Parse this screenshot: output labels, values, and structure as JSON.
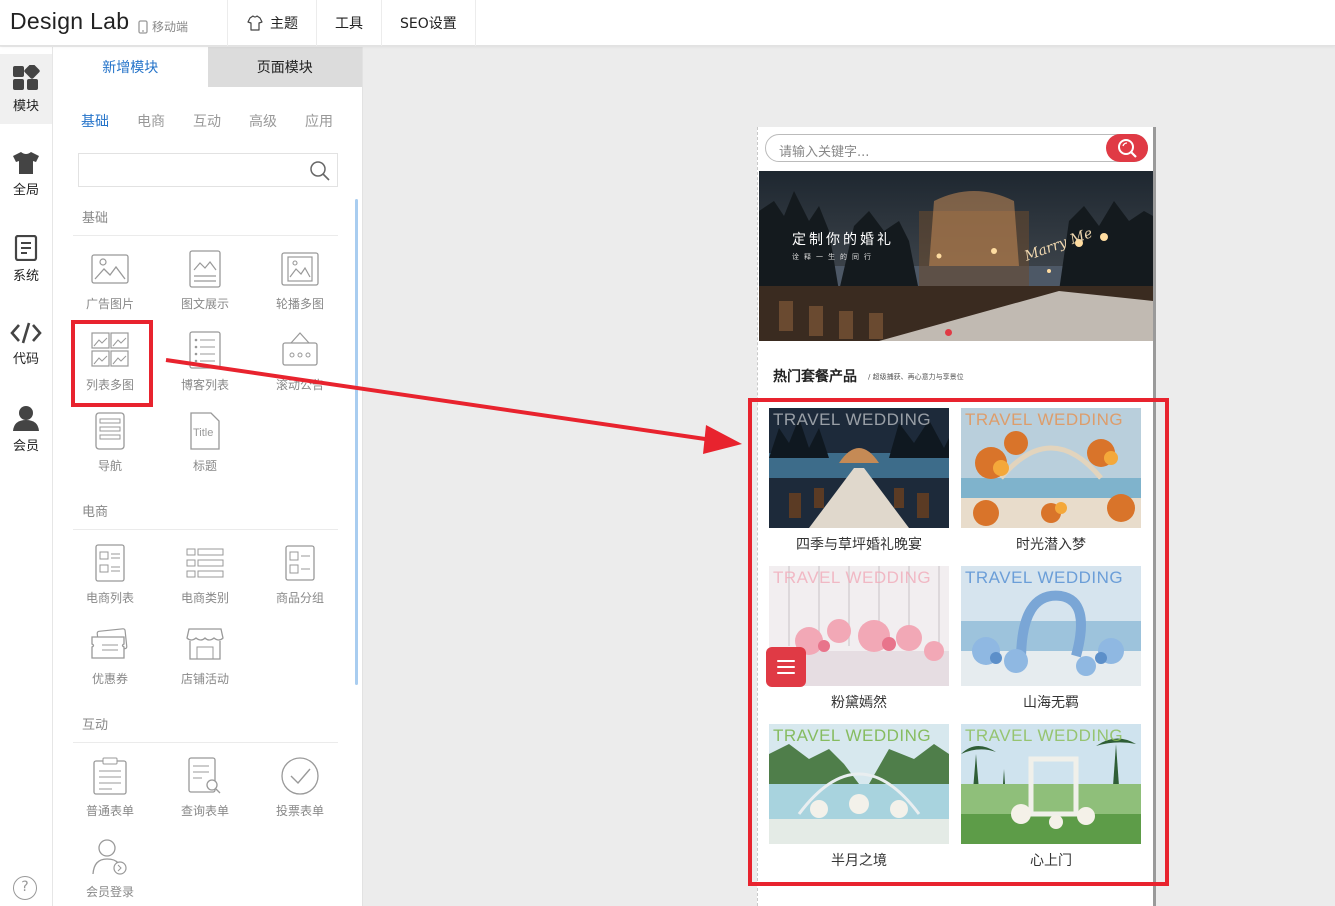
{
  "app": {
    "brand": "Design Lab",
    "mobile_label": "移动端"
  },
  "topnav": [
    {
      "label": "主题",
      "icon": "theme-icon"
    },
    {
      "label": "工具"
    },
    {
      "label": "SEO设置"
    }
  ],
  "rail": [
    {
      "label": "模块",
      "icon": "blocks-icon",
      "active": true
    },
    {
      "label": "全局",
      "icon": "shirt-icon"
    },
    {
      "label": "系统",
      "icon": "document-icon"
    },
    {
      "label": "代码",
      "icon": "code-icon"
    },
    {
      "label": "会员",
      "icon": "user-icon"
    }
  ],
  "help_label": "?",
  "panel": {
    "tabs": [
      "新增模块",
      "页面模块"
    ],
    "categories": [
      "基础",
      "电商",
      "互动",
      "高级",
      "应用"
    ],
    "search_placeholder": "",
    "sections": {
      "basic": {
        "title": "基础",
        "items": [
          "广告图片",
          "图文展示",
          "轮播多图",
          "列表多图",
          "博客列表",
          "滚动公告",
          "导航",
          "标题"
        ]
      },
      "ecommerce": {
        "title": "电商",
        "items": [
          "电商列表",
          "电商类别",
          "商品分组",
          "优惠券",
          "店铺活动"
        ]
      },
      "interaction": {
        "title": "互动",
        "items": [
          "普通表单",
          "查询表单",
          "投票表单",
          "会员登录"
        ]
      }
    }
  },
  "preview": {
    "search_placeholder": "请输入关键字...",
    "banner_title": "定制你的婚礼",
    "banner_subtitle": "诠释一生的同行",
    "section_title": "热门套餐产品",
    "section_subtitle": "/ 超级捕获、再心意力与享景位",
    "products": [
      {
        "name": "四季与草坪婚礼晚宴",
        "overlay": "TRAVEL WEDDING"
      },
      {
        "name": "时光潜入梦",
        "overlay": "TRAVEL WEDDING"
      },
      {
        "name": "粉黛嫣然",
        "overlay": "TRAVEL WEDDING"
      },
      {
        "name": "山海无羁",
        "overlay": "TRAVEL WEDDING"
      },
      {
        "name": "半月之境",
        "overlay": "TRAVEL WEDDING"
      },
      {
        "name": "心上门",
        "overlay": "TRAVEL WEDDING"
      }
    ]
  },
  "colors": {
    "accent": "#2473c9",
    "highlight": "#e8232e",
    "brand_red": "#e03a45"
  }
}
